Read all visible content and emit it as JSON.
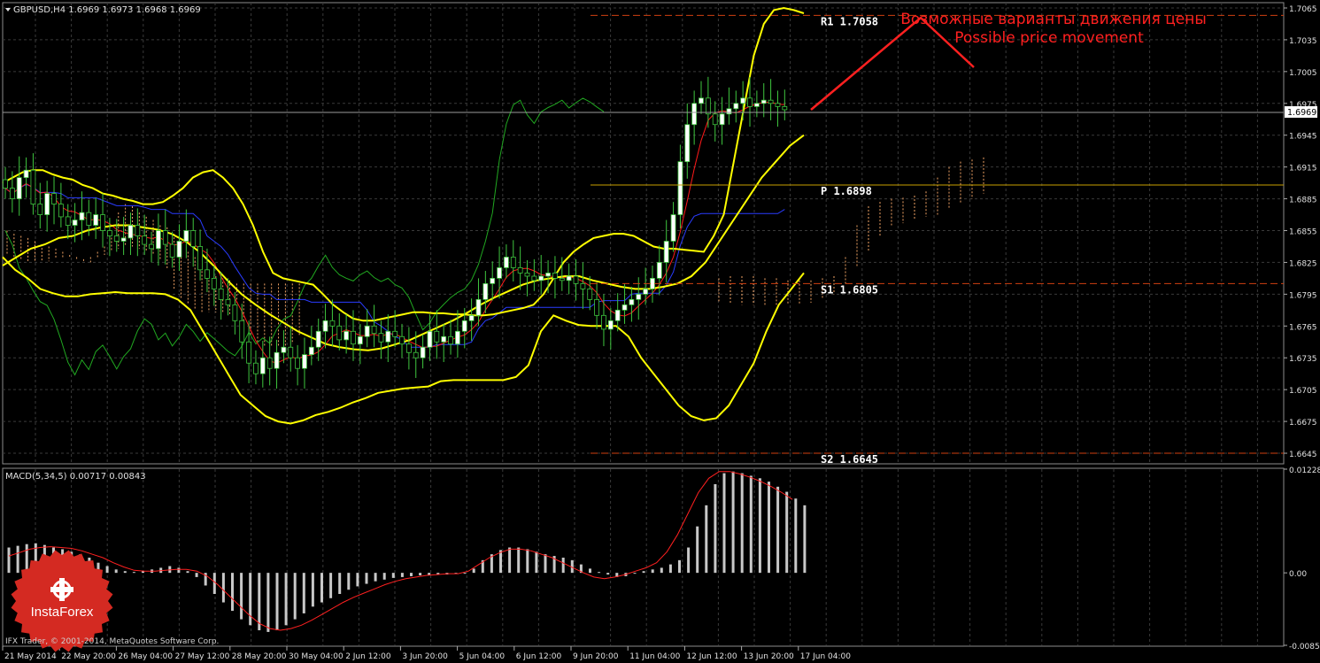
{
  "main_header": "GBPUSD,H4  1.6969 1.6973 1.6968 1.6969",
  "macd_header": "MACD(5,34,5) 0.00717 0.00843",
  "copyright": "IFX Trader, © 2001-2014, MetaQuotes Software Corp.",
  "logo_text": "InstaForex",
  "annotation": {
    "ru": "Возможные варианты движения цены",
    "en": "Possible price movement"
  },
  "current_price": "1.6969",
  "pivot_levels": [
    {
      "name": "R1",
      "label": "R1 1.7058",
      "value": 1.7058,
      "style": "dashed",
      "color": "#d04010"
    },
    {
      "name": "P",
      "label": "P 1.6898",
      "value": 1.6898,
      "style": "solid",
      "color": "#c8a000"
    },
    {
      "name": "S1",
      "label": "S1 1.6805",
      "value": 1.6805,
      "style": "dashed",
      "color": "#d04010"
    },
    {
      "name": "S2",
      "label": "S2 1.6645",
      "value": 1.6645,
      "style": "dashed",
      "color": "#d04010"
    }
  ],
  "colors": {
    "background": "#000000",
    "grid": "#3a3a3a",
    "bull_candle": "#ffffff",
    "bear_candle": "#000000",
    "wick": "#3fc63f",
    "bollinger": "#ffff00",
    "fast_ma": "#ff1a1a",
    "slow_ma": "#2a3cff",
    "chikou": "#21a821",
    "cloud": "#f2a365",
    "macd_hist": "#c8c8c8",
    "macd_signal": "#ff2020",
    "annotation": "#ff2020"
  },
  "chart_data": [
    {
      "type": "candlestick",
      "symbol": "GBPUSD",
      "timeframe": "H4",
      "ylim": [
        1.6635,
        1.707
      ],
      "y_ticks": [
        "1.7065",
        "1.7035",
        "1.7005",
        "1.6975",
        "1.6945",
        "1.6915",
        "1.6885",
        "1.6855",
        "1.6825",
        "1.6795",
        "1.6765",
        "1.6735",
        "1.6705",
        "1.6675",
        "1.6645"
      ],
      "x_labels": [
        "21 May 2014",
        "22 May 20:00",
        "26 May 04:00",
        "27 May 12:00",
        "28 May 20:00",
        "30 May 04:00",
        "2 Jun 12:00",
        "3 Jun 20:00",
        "5 Jun 04:00",
        "6 Jun 12:00",
        "9 Jun 20:00",
        "11 Jun 04:00",
        "12 Jun 12:00",
        "13 Jun 20:00",
        "17 Jun 04:00"
      ],
      "grid": true,
      "close": [
        1.6895,
        1.6885,
        1.6905,
        1.6912,
        1.688,
        1.687,
        1.689,
        1.688,
        1.6868,
        1.686,
        1.6865,
        1.6872,
        1.686,
        1.687,
        1.6855,
        1.685,
        1.6845,
        1.6848,
        1.686,
        1.685,
        1.6842,
        1.6838,
        1.6855,
        1.6842,
        1.683,
        1.6845,
        1.6855,
        1.684,
        1.6818,
        1.681,
        1.68,
        1.679,
        1.6785,
        1.677,
        1.675,
        1.673,
        1.672,
        1.6735,
        1.6725,
        1.674,
        1.6745,
        1.6735,
        1.6725,
        1.6738,
        1.6745,
        1.676,
        1.677,
        1.6765,
        1.6752,
        1.676,
        1.6748,
        1.6755,
        1.6765,
        1.6758,
        1.675,
        1.676,
        1.6755,
        1.6748,
        1.674,
        1.6735,
        1.6745,
        1.676,
        1.675,
        1.6755,
        1.6748,
        1.676,
        1.677,
        1.6775,
        1.679,
        1.6805,
        1.681,
        1.682,
        1.683,
        1.682,
        1.6815,
        1.6812,
        1.6808,
        1.6812,
        1.6815,
        1.681,
        1.6808,
        1.6812,
        1.6805,
        1.68,
        1.679,
        1.6775,
        1.6762,
        1.677,
        1.678,
        1.6785,
        1.679,
        1.6795,
        1.68,
        1.681,
        1.6825,
        1.6845,
        1.687,
        1.692,
        1.6955,
        1.6975,
        1.698,
        1.6965,
        1.6955,
        1.6965,
        1.697,
        1.6975,
        1.698,
        1.6972,
        1.6975,
        1.6978,
        1.6975,
        1.6972,
        1.6969
      ],
      "series": [
        {
          "name": "Bollinger upper",
          "values": [
            1.69,
            1.6905,
            1.691,
            1.6912,
            1.6912,
            1.6908,
            1.6905,
            1.6903,
            1.6898,
            1.6895,
            1.689,
            1.6888,
            1.6885,
            1.6883,
            1.688,
            1.688,
            1.6882,
            1.6888,
            1.6895,
            1.6905,
            1.691,
            1.6912,
            1.6905,
            1.6895,
            1.688,
            1.686,
            1.6835,
            1.6815,
            1.681,
            1.6808,
            1.6806,
            1.6804,
            1.6795,
            1.6785,
            1.6778,
            1.6772,
            1.677,
            1.677,
            1.6772,
            1.6774,
            1.6776,
            1.6778,
            1.6778,
            1.6777,
            1.6777,
            1.6776,
            1.6776,
            1.6775,
            1.6775,
            1.6776,
            1.6778,
            1.678,
            1.6782,
            1.6785,
            1.6795,
            1.681,
            1.6825,
            1.6835,
            1.6842,
            1.6848,
            1.685,
            1.6852,
            1.6852,
            1.685,
            1.6845,
            1.684,
            1.6838,
            1.6838,
            1.6837,
            1.6836,
            1.6835,
            1.685,
            1.687,
            1.692,
            1.697,
            1.702,
            1.705,
            1.7063,
            1.7065,
            1.7063,
            1.706
          ]
        },
        {
          "name": "Bollinger lower",
          "values": [
            1.683,
            1.6818,
            1.681,
            1.68,
            1.6796,
            1.6793,
            1.6793,
            1.6795,
            1.6796,
            1.6797,
            1.6796,
            1.6796,
            1.6796,
            1.6795,
            1.679,
            1.678,
            1.676,
            1.674,
            1.672,
            1.67,
            1.669,
            1.668,
            1.6675,
            1.6673,
            1.6676,
            1.6681,
            1.6684,
            1.6688,
            1.6693,
            1.6697,
            1.6702,
            1.6704,
            1.6706,
            1.6707,
            1.6708,
            1.6713,
            1.6714,
            1.6714,
            1.6714,
            1.6714,
            1.6714,
            1.6717,
            1.6728,
            1.676,
            1.6775,
            1.677,
            1.6766,
            1.6765,
            1.6765,
            1.6765,
            1.6755,
            1.6735,
            1.672,
            1.6705,
            1.669,
            1.668,
            1.6676,
            1.6678,
            1.669,
            1.671,
            1.673,
            1.676,
            1.6785,
            1.68,
            1.6815
          ]
        },
        {
          "name": "Bollinger middle",
          "values": [
            1.6822,
            1.683,
            1.6838,
            1.6842,
            1.6848,
            1.685,
            1.6855,
            1.6858,
            1.686,
            1.686,
            1.6858,
            1.6856,
            1.6852,
            1.6845,
            1.6835,
            1.6822,
            1.6808,
            1.6795,
            1.6785,
            1.6776,
            1.6768,
            1.676,
            1.6754,
            1.6748,
            1.6745,
            1.6743,
            1.6742,
            1.6744,
            1.6748,
            1.6752,
            1.6758,
            1.6764,
            1.677,
            1.6777,
            1.6785,
            1.6792,
            1.6798,
            1.6804,
            1.6808,
            1.681,
            1.6812,
            1.6812,
            1.6808,
            1.6805,
            1.6802,
            1.68,
            1.68,
            1.6802,
            1.6805,
            1.6812,
            1.6825,
            1.6845,
            1.6865,
            1.6885,
            1.6905,
            1.692,
            1.6935,
            1.6945
          ]
        }
      ]
    },
    {
      "type": "bar",
      "name": "MACD(5,34,5)",
      "ylim": [
        -0.00858,
        0.01228
      ],
      "y_ticks": [
        "0.01228",
        "0.00",
        "-0.00858"
      ],
      "values": [
        0.003,
        0.0032,
        0.0034,
        0.0035,
        0.0033,
        0.003,
        0.0028,
        0.0025,
        0.0022,
        0.0018,
        0.0012,
        0.0008,
        0.0004,
        0.0002,
        0.0001,
        0.0002,
        0.0004,
        0.0006,
        0.0008,
        0.0006,
        0.0002,
        -0.0005,
        -0.0015,
        -0.0025,
        -0.0035,
        -0.0045,
        -0.0055,
        -0.0062,
        -0.0068,
        -0.007,
        -0.0068,
        -0.0062,
        -0.0055,
        -0.0048,
        -0.004,
        -0.0035,
        -0.003,
        -0.0025,
        -0.002,
        -0.0016,
        -0.0013,
        -0.001,
        -0.0008,
        -0.0006,
        -0.0005,
        -0.0004,
        -0.0003,
        -0.0003,
        -0.0002,
        -0.0002,
        -0.0001,
        0.0,
        0.0005,
        0.0015,
        0.0022,
        0.0027,
        0.003,
        0.003,
        0.0028,
        0.0025,
        0.0022,
        0.002,
        0.0018,
        0.0015,
        0.001,
        0.0005,
        0.0001,
        -0.0002,
        -0.0005,
        -0.0004,
        0.0,
        0.0002,
        0.0004,
        0.0006,
        0.001,
        0.0015,
        0.003,
        0.0055,
        0.008,
        0.0105,
        0.0118,
        0.012,
        0.0118,
        0.0115,
        0.0112,
        0.0108,
        0.0102,
        0.0096,
        0.0088,
        0.008
      ],
      "signal": [
        0.002,
        0.0024,
        0.0028,
        0.003,
        0.0031,
        0.003,
        0.0029,
        0.0026,
        0.0022,
        0.0018,
        0.0012,
        0.0007,
        0.0003,
        0.0002,
        0.0002,
        0.0003,
        0.0004,
        0.0004,
        0.0002,
        -0.0004,
        -0.0014,
        -0.0026,
        -0.0038,
        -0.005,
        -0.006,
        -0.0066,
        -0.0068,
        -0.0066,
        -0.0062,
        -0.0056,
        -0.0049,
        -0.0042,
        -0.0035,
        -0.0029,
        -0.0024,
        -0.0019,
        -0.0014,
        -0.001,
        -0.0007,
        -0.0005,
        -0.0003,
        -0.0002,
        -0.0001,
        -0.0001,
        0.0002,
        0.001,
        0.0018,
        0.0024,
        0.0028,
        0.0028,
        0.0026,
        0.0022,
        0.0018,
        0.0012,
        0.0006,
        0.0,
        -0.0005,
        -0.0007,
        -0.0005,
        -0.0002,
        0.0002,
        0.0006,
        0.0012,
        0.0025,
        0.0045,
        0.007,
        0.0095,
        0.0112,
        0.012,
        0.012,
        0.0117,
        0.0113,
        0.0108,
        0.0102,
        0.0095,
        0.0087
      ]
    }
  ]
}
